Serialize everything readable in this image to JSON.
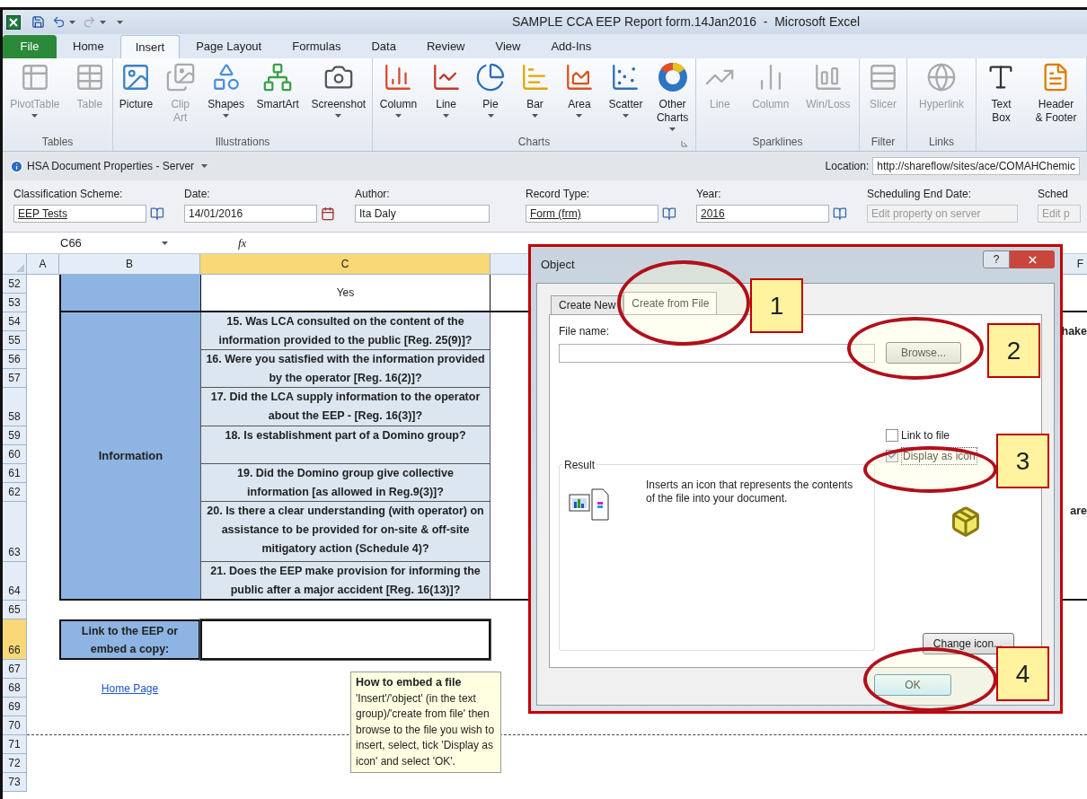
{
  "window": {
    "title": "SAMPLE CCA EEP Report form.14Jan2016  -  Microsoft Excel"
  },
  "ribbon_tabs": [
    {
      "label": "File",
      "kind": "file",
      "selected": false
    },
    {
      "label": "Home",
      "kind": "tab",
      "selected": false
    },
    {
      "label": "Insert",
      "kind": "tab",
      "selected": true
    },
    {
      "label": "Page Layout",
      "kind": "tab",
      "selected": false
    },
    {
      "label": "Formulas",
      "kind": "tab",
      "selected": false
    },
    {
      "label": "Data",
      "kind": "tab",
      "selected": false
    },
    {
      "label": "Review",
      "kind": "tab",
      "selected": false
    },
    {
      "label": "View",
      "kind": "tab",
      "selected": false
    },
    {
      "label": "Add-Ins",
      "kind": "tab",
      "selected": false
    }
  ],
  "ribbon_groups": [
    {
      "label": "Tables",
      "items": [
        {
          "label": "PivotTable",
          "disabled": true,
          "dropdown": true
        },
        {
          "label": "Table",
          "disabled": true,
          "dropdown": false
        }
      ]
    },
    {
      "label": "Illustrations",
      "items": [
        {
          "label": "Picture",
          "disabled": false,
          "dropdown": false
        },
        {
          "label": "Clip\nArt",
          "disabled": true,
          "dropdown": false
        },
        {
          "label": "Shapes",
          "disabled": false,
          "dropdown": true
        },
        {
          "label": "SmartArt",
          "disabled": false,
          "dropdown": false
        },
        {
          "label": "Screenshot",
          "disabled": false,
          "dropdown": true
        }
      ]
    },
    {
      "label": "Charts",
      "launcher": true,
      "items": [
        {
          "label": "Column",
          "disabled": false,
          "dropdown": true
        },
        {
          "label": "Line",
          "disabled": false,
          "dropdown": true
        },
        {
          "label": "Pie",
          "disabled": false,
          "dropdown": true
        },
        {
          "label": "Bar",
          "disabled": false,
          "dropdown": true
        },
        {
          "label": "Area",
          "disabled": false,
          "dropdown": true
        },
        {
          "label": "Scatter",
          "disabled": false,
          "dropdown": true
        },
        {
          "label": "Other\nCharts",
          "disabled": false,
          "dropdown": true
        }
      ]
    },
    {
      "label": "Sparklines",
      "items": [
        {
          "label": "Line",
          "disabled": true,
          "dropdown": false
        },
        {
          "label": "Column",
          "disabled": true,
          "dropdown": false
        },
        {
          "label": "Win/Loss",
          "disabled": true,
          "dropdown": false
        }
      ]
    },
    {
      "label": "Filter",
      "items": [
        {
          "label": "Slicer",
          "disabled": true,
          "dropdown": false
        }
      ]
    },
    {
      "label": "Links",
      "items": [
        {
          "label": "Hyperlink",
          "disabled": true,
          "dropdown": false
        }
      ]
    },
    {
      "items": [
        {
          "label": "Text\nBox",
          "disabled": false,
          "dropdown": false
        },
        {
          "label": "Header\n& Footer",
          "disabled": false,
          "dropdown": false
        }
      ]
    }
  ],
  "document_properties": {
    "title": "HSA Document Properties - Server",
    "location_label": "Location:",
    "location": "http://shareflow/sites/ace/COMAHChemic",
    "fields": [
      {
        "label": "Classification Scheme:",
        "value": "EEP Tests",
        "kind": "lookup"
      },
      {
        "label": "Date:",
        "value": "14/01/2016",
        "kind": "date"
      },
      {
        "label": "Author:",
        "value": "Ita Daly",
        "kind": "text"
      },
      {
        "label": "Record Type:",
        "value": "Form (frm)",
        "kind": "lookup"
      },
      {
        "label": "Year:",
        "value": "2016",
        "kind": "lookup"
      },
      {
        "label": "Scheduling End Date:",
        "placeholder": "Edit property on server",
        "kind": "server"
      },
      {
        "label": "Sched",
        "placeholder": "Edit p",
        "kind": "server"
      }
    ]
  },
  "formula_bar": {
    "name_box": "C66",
    "function_label": "fx"
  },
  "sheet": {
    "columns": [
      {
        "label": "A",
        "selected": false
      },
      {
        "label": "B",
        "selected": false
      },
      {
        "label": "C",
        "selected": true
      }
    ],
    "edge_column": "F",
    "rows": [
      {
        "label": "52",
        "selected": false
      },
      {
        "label": "53",
        "selected": false
      },
      {
        "label": "54",
        "selected": false
      },
      {
        "label": "55",
        "selected": false
      },
      {
        "label": "56",
        "selected": false
      },
      {
        "label": "57",
        "selected": false
      },
      {
        "label": "58",
        "selected": false
      },
      {
        "label": "59",
        "selected": false
      },
      {
        "label": "60",
        "selected": false
      },
      {
        "label": "61",
        "selected": false
      },
      {
        "label": "62",
        "selected": false
      },
      {
        "label": "63",
        "selected": false
      },
      {
        "label": "64",
        "selected": false
      },
      {
        "label": "65",
        "selected": false
      },
      {
        "label": "66",
        "selected": true
      },
      {
        "label": "67",
        "selected": false
      },
      {
        "label": "68",
        "selected": false
      },
      {
        "label": "69",
        "selected": false
      },
      {
        "label": "70",
        "selected": false
      },
      {
        "label": "71",
        "selected": false
      },
      {
        "label": "72",
        "selected": false
      },
      {
        "label": "73",
        "selected": false
      }
    ],
    "answer": "Yes",
    "category": "Information",
    "questions": [
      "15. Was LCA consulted on the content of the information provided to the public [Reg. 25(9)]?",
      "16. Were you satisfied with the  information provided by the operator [Reg. 16(2)]?",
      "17. Did the LCA supply information to the operator about the EEP - [Reg. 16(3)]?",
      "18. Is establishment part of a Domino group?",
      "19. Did the Domino group give collective information [as allowed in Reg.9(3)]?",
      "20. Is there a clear understanding (with operator) on assistance to be provided for on-site & off-site mitigatory action (Schedule 4)?",
      "21. Does the EEP make provision for informing the public after a major accident [Reg. 16(13)]?"
    ],
    "edge_texts": [
      "hake",
      "are"
    ],
    "link_label": "Link to the EEP or embed a copy:",
    "home_link": "Home Page"
  },
  "comment": {
    "title": "How to embed a file",
    "body": "'Insert'/'object' (in the text group)/'create from file' then browse to the file you wish to insert, select, tick 'Display as icon' and select 'OK'."
  },
  "dialog": {
    "title": "Object",
    "help": "?",
    "tabs": [
      {
        "label": "Create New",
        "selected": false
      },
      {
        "label": "Create from File",
        "selected": true
      }
    ],
    "file_name_label": "File name:",
    "browse": "Browse...",
    "options": [
      {
        "label": "Link to file",
        "checked": false
      },
      {
        "label": "Display as icon",
        "checked": true
      }
    ],
    "result_label": "Result",
    "result_text": "Inserts an icon that represents the contents of the file into your document.",
    "change_icon": "Change icon...",
    "ok": "OK"
  },
  "annotations": [
    "1",
    "2",
    "3",
    "4"
  ]
}
